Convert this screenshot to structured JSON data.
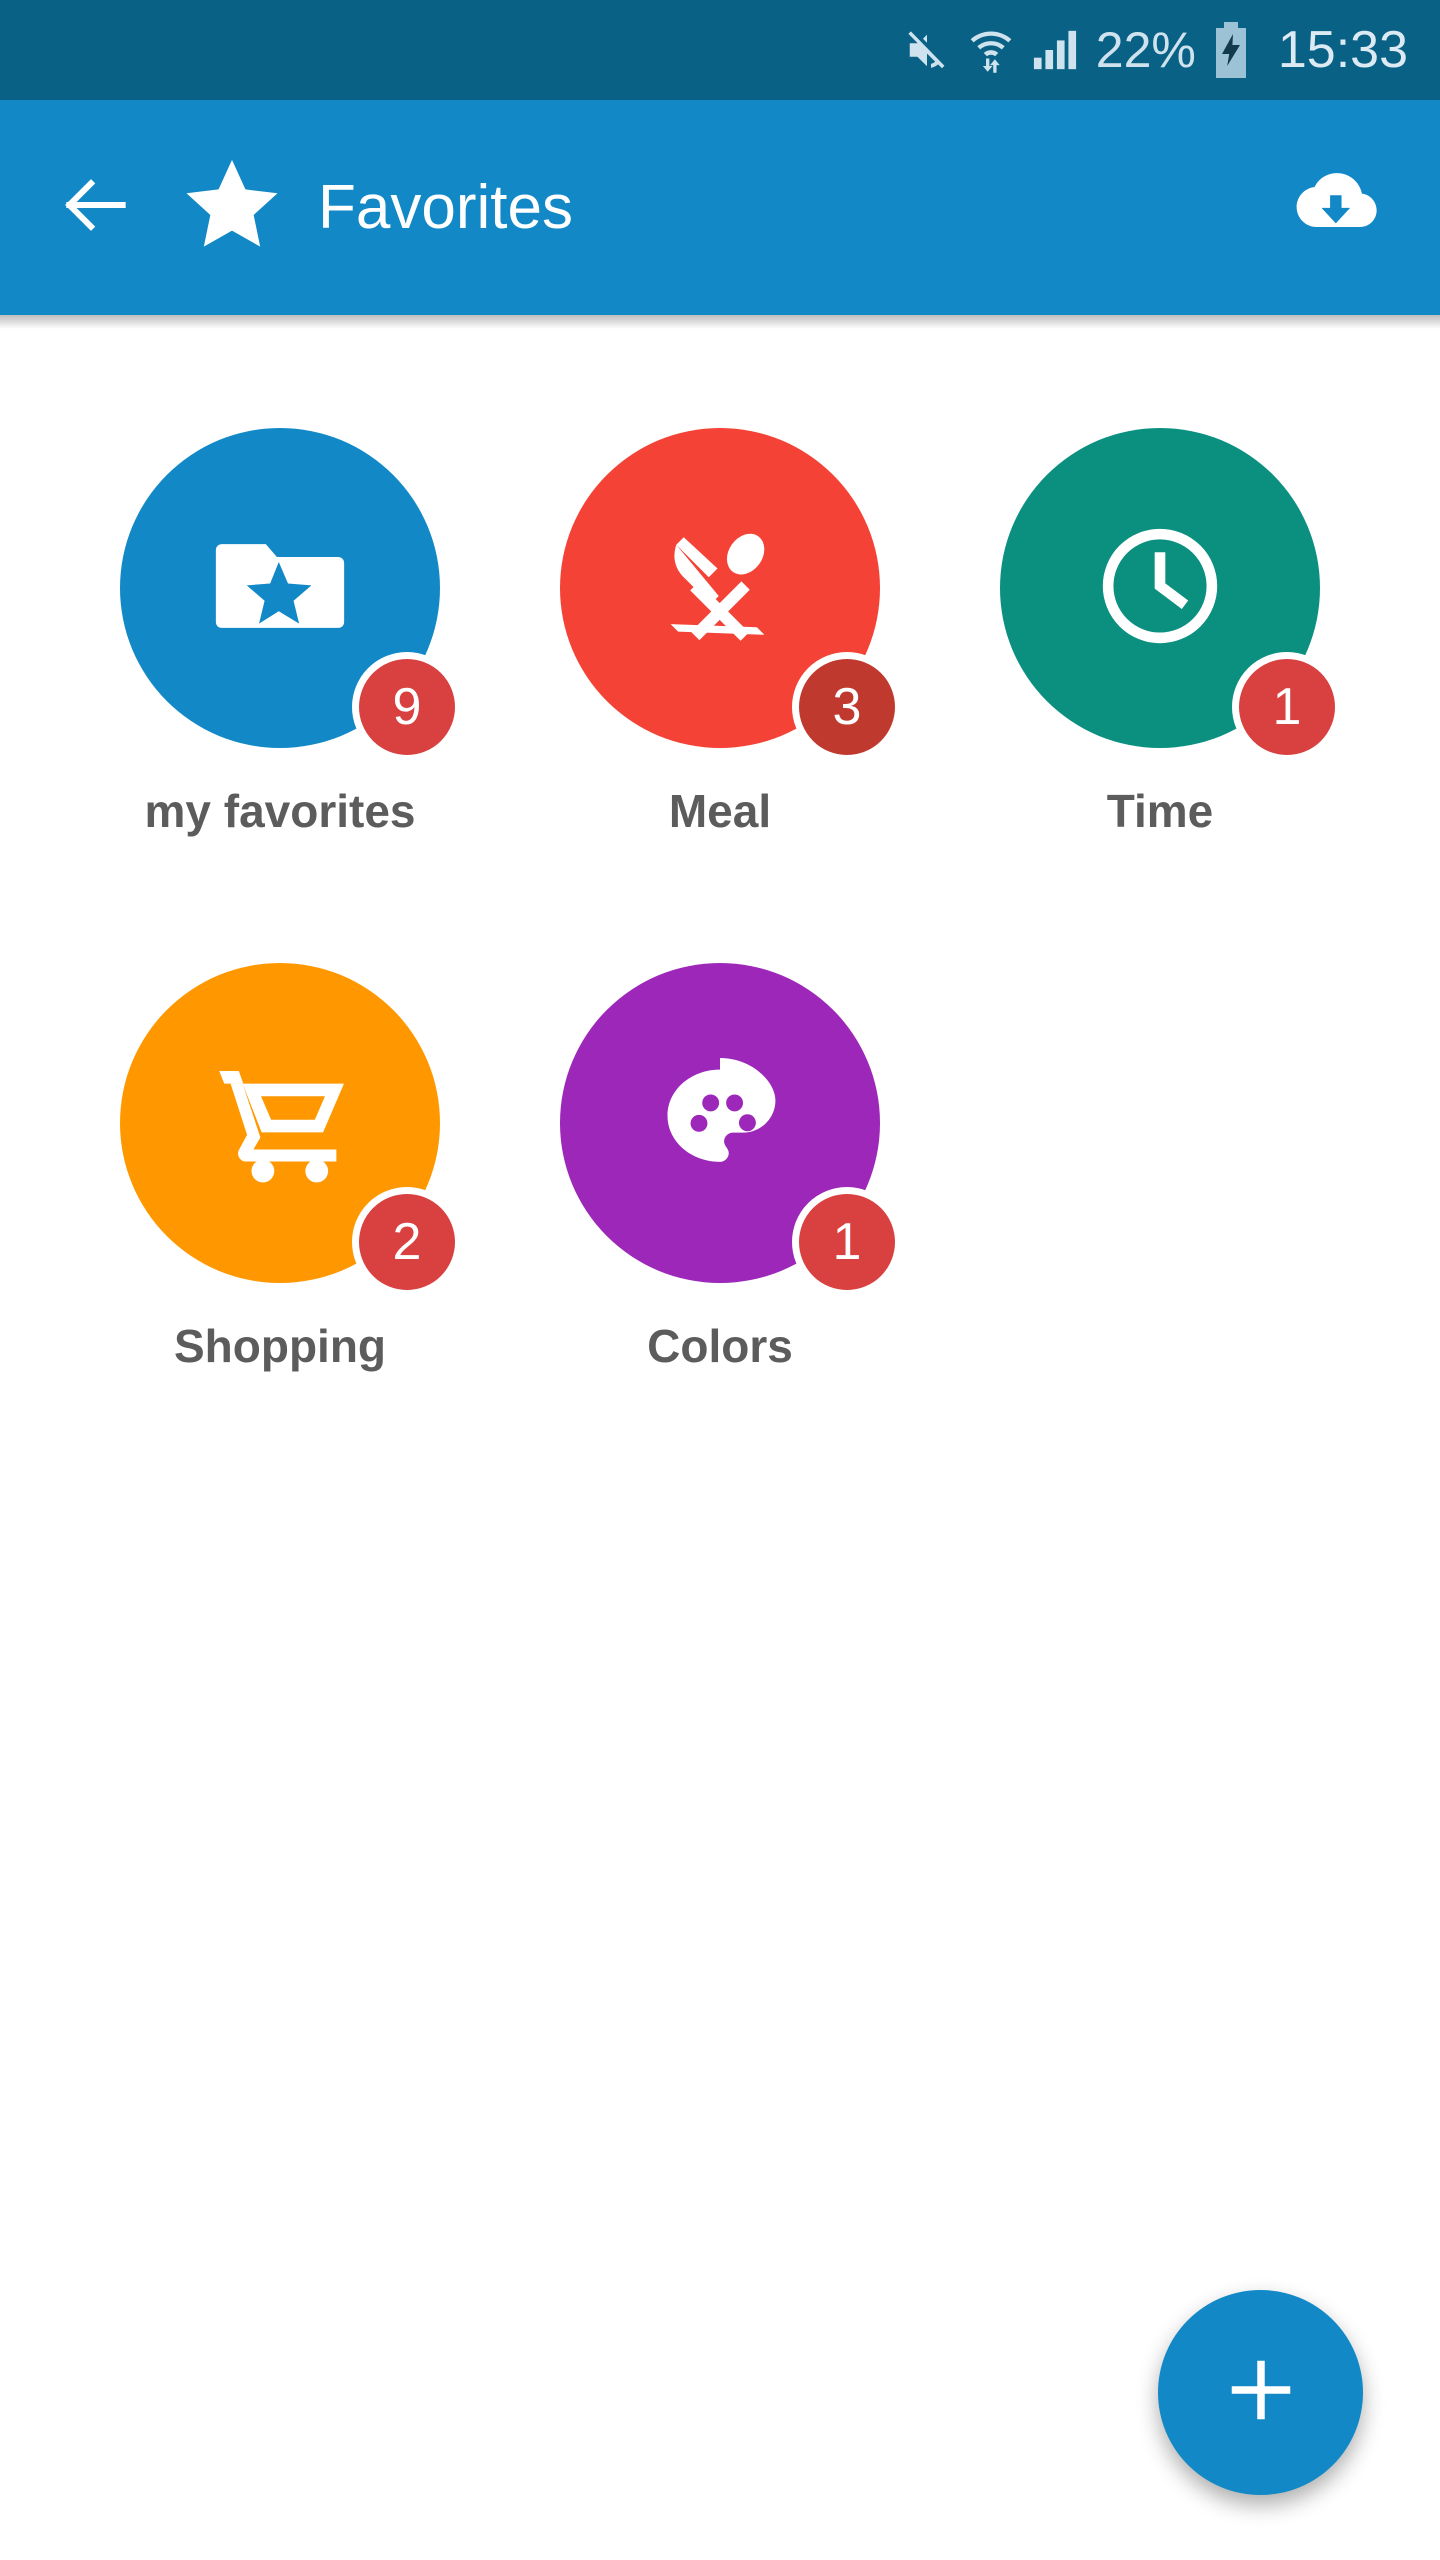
{
  "status_bar": {
    "background": "#0a6186",
    "mute_icon": "mute-icon",
    "wifi_icon": "wifi-icon",
    "signal_icon": "signal-bars-icon",
    "battery_percent": "22%",
    "battery_icon": "battery-charging-icon",
    "time": "15:33"
  },
  "app_bar": {
    "background": "#1289c6",
    "back_icon": "back-arrow-icon",
    "logo_icon": "star-icon",
    "title": "Favorites",
    "action_icon": "cloud-download-icon"
  },
  "grid": {
    "items": [
      {
        "label": "my favorites",
        "badge": "9",
        "color": "#1289c6",
        "icon": "folder-star-icon"
      },
      {
        "label": "Meal",
        "badge": "3",
        "color": "#f44336",
        "icon": "knife-spoon-icon"
      },
      {
        "label": "Time",
        "badge": "1",
        "color": "#0b9080",
        "icon": "clock-icon"
      },
      {
        "label": "Shopping",
        "badge": "2",
        "color": "#ff9800",
        "icon": "shopping-cart-icon"
      },
      {
        "label": "Colors",
        "badge": "1",
        "color": "#9c27b8",
        "icon": "palette-icon"
      }
    ],
    "badge_color": "#d94040",
    "label_color": "#5c5c5c"
  },
  "fab": {
    "icon": "plus-icon",
    "color": "#1289c6"
  }
}
